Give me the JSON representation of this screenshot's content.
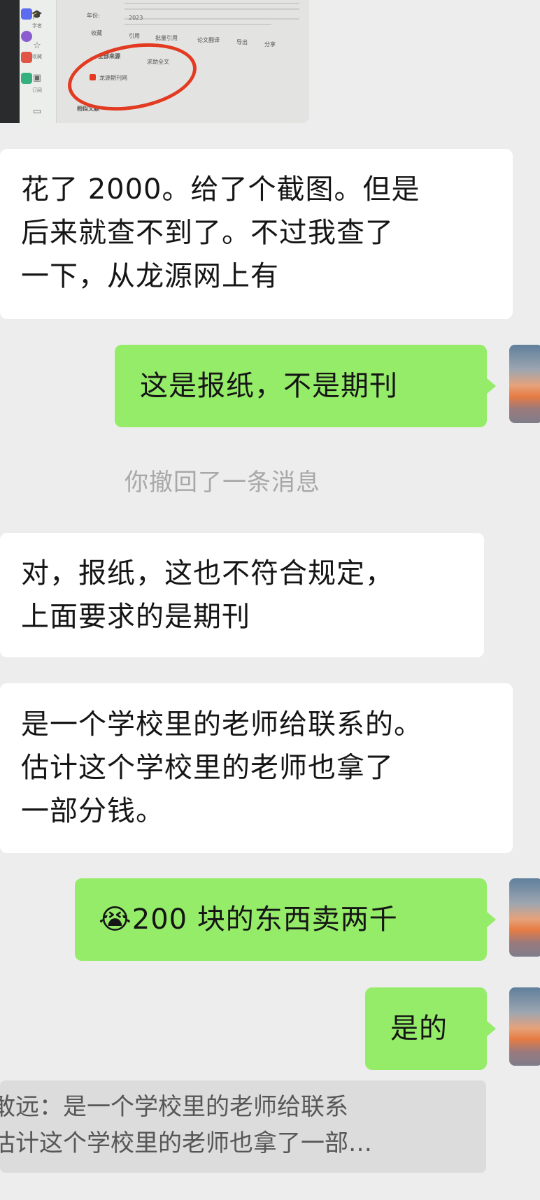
{
  "screenshot": {
    "sidebar_labels": [
      "学者",
      "收藏",
      "订阅"
    ],
    "meta_label": "年份:",
    "meta_value": "2023",
    "toolbar": [
      "收藏",
      "引用",
      "批量引用",
      "论文翻译",
      "导出",
      "分享"
    ],
    "source_tab_all": "全部来源",
    "source_tab_fulltext": "求助全文",
    "source_item": "龙源期刊网",
    "related": "相似文献",
    "annotation_color": "#e23b22"
  },
  "messages": [
    {
      "side": "received",
      "lines": [
        "花了 2000。给了个截图。但是",
        "后来就查不到了。不过我查了",
        "一下，从龙源网上有"
      ]
    },
    {
      "side": "sent",
      "lines": [
        "这是报纸，不是期刊"
      ]
    },
    {
      "side": "system",
      "text": "你撤回了一条消息"
    },
    {
      "side": "received",
      "lines": [
        "对，报纸，这也不符合规定，",
        "上面要求的是期刊"
      ]
    },
    {
      "side": "received",
      "lines": [
        "是一个学校里的老师给联系的。",
        "估计这个学校里的老师也拿了",
        "一部分钱。"
      ]
    },
    {
      "side": "sent",
      "emoji": "😭",
      "lines": [
        "200 块的东西卖两千"
      ]
    },
    {
      "side": "sent",
      "lines": [
        "是的"
      ]
    }
  ],
  "quote": {
    "lines": [
      "敢远：是一个学校里的老师给联系",
      "估计这个学校里的老师也拿了一部…"
    ]
  },
  "colors": {
    "background": "#ededed",
    "sent_bubble": "#95ec69",
    "received_bubble": "#ffffff",
    "system_text": "#a8a8a8"
  }
}
